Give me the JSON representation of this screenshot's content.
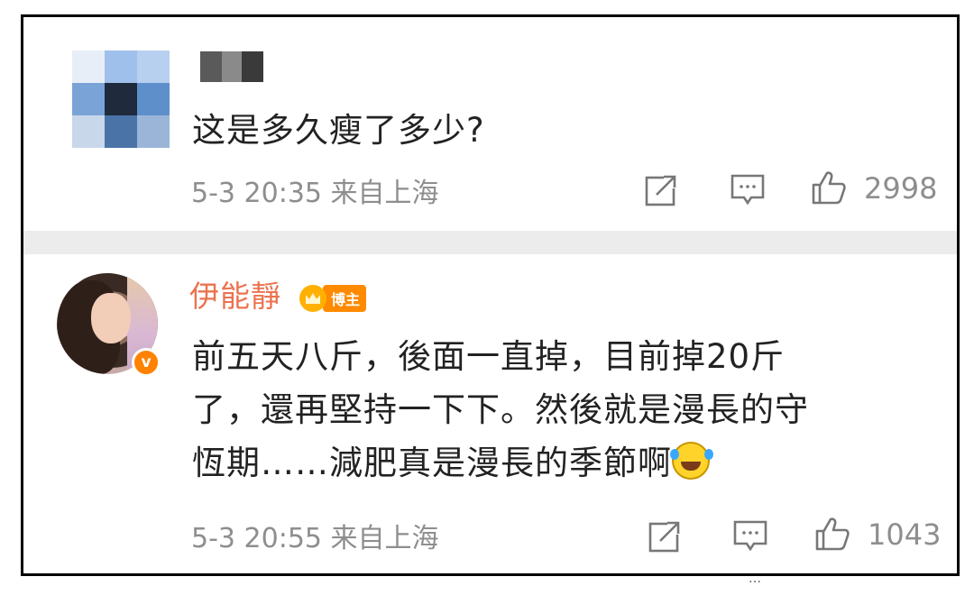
{
  "comments": [
    {
      "username": "",
      "text": "这是多久瘦了多少?",
      "meta": "5-3 20:35 来自上海",
      "likes": "2998",
      "avatar_style": "pixelated",
      "icons": [
        "share-icon",
        "comment-icon",
        "like-icon"
      ]
    },
    {
      "username": "伊能靜",
      "badge": "博主",
      "text_lines": [
        "前五天八斤，後面一直掉，目前掉20斤",
        "了，還再堅持一下下。然後就是漫長的守",
        "恆期……減肥真是漫長的季節啊"
      ],
      "meta": "5-3 20:55 来自上海",
      "likes": "1043",
      "verified_mark": "v",
      "emoji": "laugh-cry-emoji",
      "icons": [
        "share-icon",
        "comment-icon",
        "like-icon"
      ]
    }
  ],
  "colors": {
    "username": "#eb7350",
    "meta": "#8e8e8e",
    "badge": "#ff8a00",
    "verified": "#ff8200",
    "separator": "#ececec"
  },
  "watermark": "…"
}
